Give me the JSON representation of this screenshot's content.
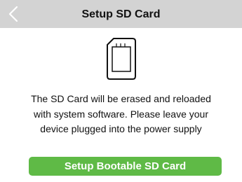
{
  "header": {
    "title": "Setup SD Card",
    "back_icon": "chevron-left-icon"
  },
  "main": {
    "icon": "sd-card-icon",
    "message_lines": [
      "The SD Card will be erased and reloaded",
      "with system software. Please leave your",
      "device plugged into the power supply"
    ],
    "button_label": "Setup Bootable SD Card"
  },
  "colors": {
    "header_background": "#d3d3d3",
    "back_icon": "#ffffff",
    "button_background": "#5fba46",
    "button_text": "#ffffff",
    "text": "#111111"
  }
}
